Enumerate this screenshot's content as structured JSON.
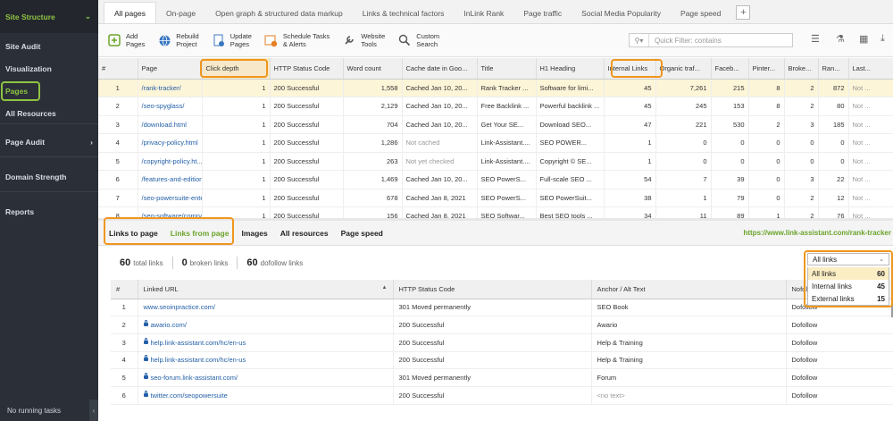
{
  "sidebar": {
    "header": "Site Structure",
    "items": [
      {
        "label": "Site Audit",
        "chevron": ""
      },
      {
        "label": "Visualization",
        "chevron": ""
      },
      {
        "label": "Pages",
        "chevron": ""
      },
      {
        "label": "All Resources",
        "chevron": ""
      },
      {
        "label": "Page Audit",
        "chevron": "›"
      },
      {
        "label": "Domain Strength",
        "chevron": ""
      },
      {
        "label": "Reports",
        "chevron": ""
      }
    ],
    "status": "No running tasks",
    "collapse_glyph": "‹",
    "header_chevron": "⌄"
  },
  "tabs": [
    "All pages",
    "On-page",
    "Open graph & structured data markup",
    "Links & technical factors",
    "InLink Rank",
    "Page traffic",
    "Social Media Popularity",
    "Page speed"
  ],
  "tab_add": "+",
  "toolbar": {
    "add": "Add\nPages",
    "rebuild": "Rebuild\nProject",
    "update": "Update\nPages",
    "schedule": "Schedule Tasks\n& Alerts",
    "website_tools": "Website\nTools",
    "custom_search": "Custom\nSearch",
    "filter_placeholder": "Quick Filter: contains"
  },
  "grid": {
    "columns": [
      "#",
      "Page",
      "Click depth",
      "HTTP Status Code",
      "Word count",
      "Cache date in Goo...",
      "Title",
      "H1 Heading",
      "Internal Links",
      "Organic traf...",
      "Faceb...",
      "Pinter...",
      "Broke...",
      "Ran...",
      "Last..."
    ],
    "rows": [
      [
        "1",
        "/rank-tracker/",
        "1",
        "200 Successful",
        "1,558",
        "Cached Jan 10, 20...",
        "Rank Tracker ...",
        "Software for limi...",
        "45",
        "7,261",
        "215",
        "8",
        "2",
        "872",
        "Not ..."
      ],
      [
        "2",
        "/seo-spyglass/",
        "1",
        "200 Successful",
        "2,129",
        "Cached Jan 10, 20...",
        "Free Backlink ...",
        "Powerful backlink ...",
        "45",
        "245",
        "153",
        "8",
        "2",
        "80",
        "Not ..."
      ],
      [
        "3",
        "/download.html",
        "1",
        "200 Successful",
        "704",
        "Cached Jan 10, 20...",
        "Get Your SE...",
        "Download SEO...",
        "47",
        "221",
        "530",
        "2",
        "3",
        "185",
        "Not ..."
      ],
      [
        "4",
        "/privacy-policy.html",
        "1",
        "200 Successful",
        "1,286",
        "Not cached",
        "Link-Assistant....",
        "SEO POWER...",
        "1",
        "0",
        "0",
        "0",
        "0",
        "0",
        "Not ..."
      ],
      [
        "5",
        "/copyright-policy.ht...",
        "1",
        "200 Successful",
        "263",
        "Not yet checked",
        "Link-Assistant....",
        "Copyright © SE...",
        "1",
        "0",
        "0",
        "0",
        "0",
        "0",
        "Not ..."
      ],
      [
        "6",
        "/features-and-editions",
        "1",
        "200 Successful",
        "1,469",
        "Cached Jan 10, 20...",
        "SEO PowerS...",
        "Full-scale SEO ...",
        "54",
        "7",
        "39",
        "0",
        "3",
        "22",
        "Not ..."
      ],
      [
        "7",
        "/seo-powersuite-ente",
        "1",
        "200 Successful",
        "678",
        "Cached Jan 8, 2021",
        "SEO PowerS...",
        "SEO PowerSuit...",
        "38",
        "1",
        "79",
        "0",
        "2",
        "12",
        "Not ..."
      ],
      [
        "8",
        "/seo-software/compa",
        "1",
        "200 Successful",
        "156",
        "Cached Jan 8, 2021",
        "SEO Softwar...",
        "Best SEO tools ...",
        "34",
        "11",
        "89",
        "1",
        "2",
        "76",
        "Not ..."
      ]
    ]
  },
  "subtabs": [
    "Links to page",
    "Links from page",
    "Images",
    "All resources",
    "Page speed"
  ],
  "subtab_url": "https://www.link-assistant.com/rank-tracker",
  "summary": {
    "total": "60",
    "total_label": "total links",
    "broken": "0",
    "broken_label": "broken links",
    "dofollow": "60",
    "dofollow_label": "dofollow links"
  },
  "dropdown": {
    "selected": "All links",
    "options": [
      {
        "label": "All links",
        "count": "60"
      },
      {
        "label": "Internal links",
        "count": "45"
      },
      {
        "label": "External links",
        "count": "15"
      }
    ]
  },
  "links": {
    "columns": [
      "#",
      "Linked URL",
      "HTTP Status Code",
      "Anchor / Alt Text",
      "Nofol..."
    ],
    "sort_glyph": "▲",
    "rows": [
      [
        "1",
        "www.seoinpractice.com/",
        "301 Moved permanently",
        "SEO Book",
        "Dofollow"
      ],
      [
        "2",
        "awario.com/",
        "200 Successful",
        "Awario",
        "Dofollow"
      ],
      [
        "3",
        "help.link-assistant.com/hc/en-us",
        "200 Successful",
        "Help & Training",
        "Dofollow"
      ],
      [
        "4",
        "help.link-assistant.com/hc/en-us",
        "200 Successful",
        "Help & Training",
        "Dofollow"
      ],
      [
        "5",
        "seo-forum.link-assistant.com/",
        "301 Moved permanently",
        "Forum",
        "Dofollow"
      ],
      [
        "6",
        "twitter.com/seopowersuite",
        "200 Successful",
        "<no text>",
        "Dofollow"
      ]
    ],
    "secure": [
      false,
      true,
      true,
      true,
      true,
      true
    ]
  },
  "colors": {
    "accent_green": "#8fc341",
    "highlight_orange": "#f0961e",
    "link_blue": "#2460a7"
  }
}
